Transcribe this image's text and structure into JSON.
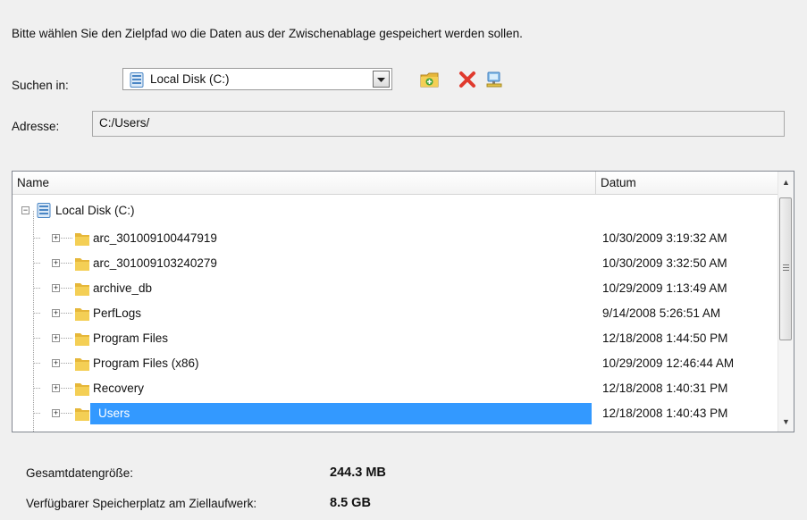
{
  "instruction": "Bitte wählen Sie den Zielpfad wo die Daten aus der Zwischenablage gespeichert werden sollen.",
  "location": {
    "label": "Suchen in:",
    "selected": "Local Disk (C:)",
    "icon": "drive-icon"
  },
  "toolbar": {
    "new_folder_icon": "new-folder-icon",
    "delete_icon": "delete-icon",
    "network_icon": "network-drive-icon"
  },
  "address": {
    "label": "Adresse:",
    "value": "C:/Users/"
  },
  "tree": {
    "columns": [
      "Name",
      "Datum"
    ],
    "root": {
      "name": "Local Disk (C:)",
      "expanded": true
    },
    "items": [
      {
        "name": "arc_301009100447919",
        "date": "10/30/2009 3:19:32 AM"
      },
      {
        "name": "arc_301009103240279",
        "date": "10/30/2009 3:32:50 AM"
      },
      {
        "name": "archive_db",
        "date": "10/29/2009 1:13:49 AM"
      },
      {
        "name": "PerfLogs",
        "date": "9/14/2008 5:26:51 AM"
      },
      {
        "name": "Program Files",
        "date": "12/18/2008 1:44:50 PM"
      },
      {
        "name": "Program Files (x86)",
        "date": "10/29/2009 12:46:44 AM"
      },
      {
        "name": "Recovery",
        "date": "12/18/2008 1:40:31 PM"
      },
      {
        "name": "Users",
        "date": "12/18/2008 1:40:43 PM",
        "selected": true
      }
    ]
  },
  "summary": {
    "total_label": "Gesamtdatengröße:",
    "total_value": "244.3 MB",
    "available_label": "Verfügbarer Speicherplatz am Ziellaufwerk:",
    "available_value": "8.5 GB"
  },
  "colors": {
    "selection": "#3399ff",
    "folder": "#f2c744",
    "delete": "#e03a2e",
    "background": "#f0f0f0"
  }
}
